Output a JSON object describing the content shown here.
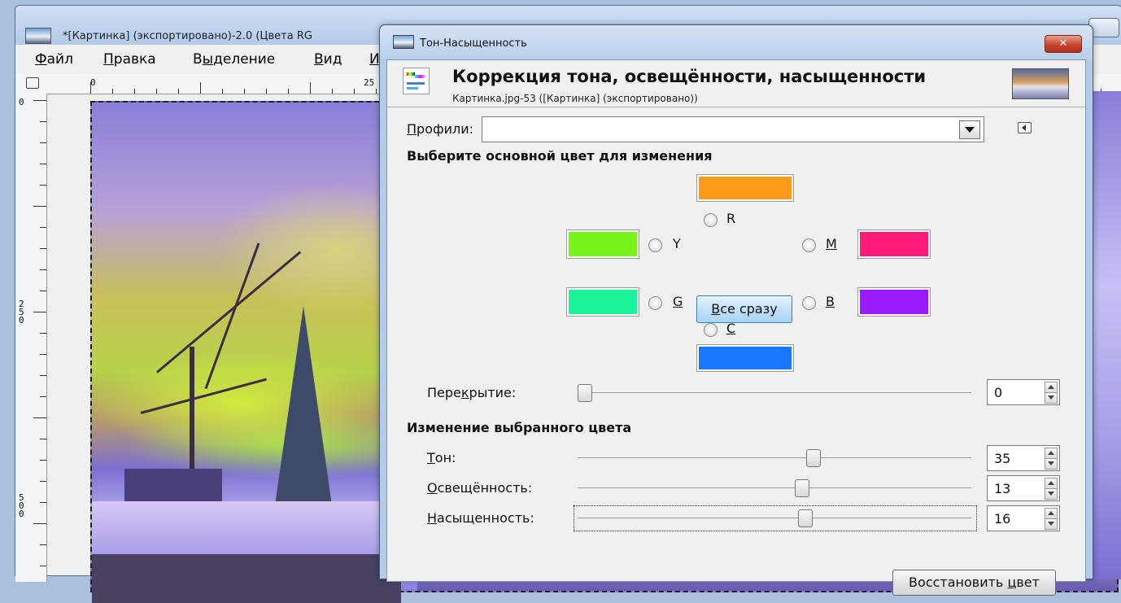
{
  "background_window": {
    "title": "*[Картинка] (экспортировано)-2.0 (Цвета RG",
    "menu": [
      {
        "pre": "",
        "acc": "Ф",
        "post": "айл"
      },
      {
        "pre": "",
        "acc": "П",
        "post": "равка"
      },
      {
        "pre": "В",
        "acc": "ы",
        "post": "деление"
      },
      {
        "pre": "",
        "acc": "В",
        "post": "ид"
      },
      {
        "pre": "",
        "acc": "И",
        "post": ""
      }
    ],
    "hruler_labels": [
      "0",
      "25"
    ],
    "vruler_labels": [
      "0",
      "2\n5\n0",
      "5\n0\n0"
    ]
  },
  "dialog": {
    "title": "Тон-Насыщенность",
    "close_label": "✕",
    "header_title": "Коррекция тона, освещённости, насыщенности",
    "header_subtitle": "Картинка.jpg-53 ([Картинка] (экспортировано))",
    "presets": {
      "pre": "",
      "acc": "П",
      "post": "рофили:",
      "value": ""
    },
    "select_section": "Выберите основной цвет для изменения",
    "colors": {
      "R": {
        "label": "R",
        "color": "#ff9a1a"
      },
      "Y": {
        "label": "Y",
        "color": "#77f51a"
      },
      "M": {
        "label": "M",
        "color": "#ff1a77"
      },
      "G": {
        "label": "G",
        "color": "#1af59a"
      },
      "B": {
        "label": "B",
        "color": "#9a1aff"
      },
      "C": {
        "label": "C",
        "color": "#1a77ff"
      }
    },
    "all_button": {
      "pre": "",
      "acc": "В",
      "post": "се сразу"
    },
    "overlap": {
      "pre": "Пере",
      "acc": "к",
      "post": "рытие:",
      "value": "0",
      "level": 0
    },
    "adjust_section": "Изменение выбранного цвета",
    "hue": {
      "pre": "",
      "acc": "Т",
      "post": "он:",
      "value": "35",
      "level": 0.6
    },
    "lightness": {
      "pre": "",
      "acc": "О",
      "post": "свещённость:",
      "value": "13",
      "level": 0.57
    },
    "saturation": {
      "pre": "",
      "acc": "Н",
      "post": "асыщенность:",
      "value": "16",
      "level": 0.58
    },
    "reset_button": {
      "pre": "Восстановить ",
      "acc": "ц",
      "post": "вет"
    }
  }
}
